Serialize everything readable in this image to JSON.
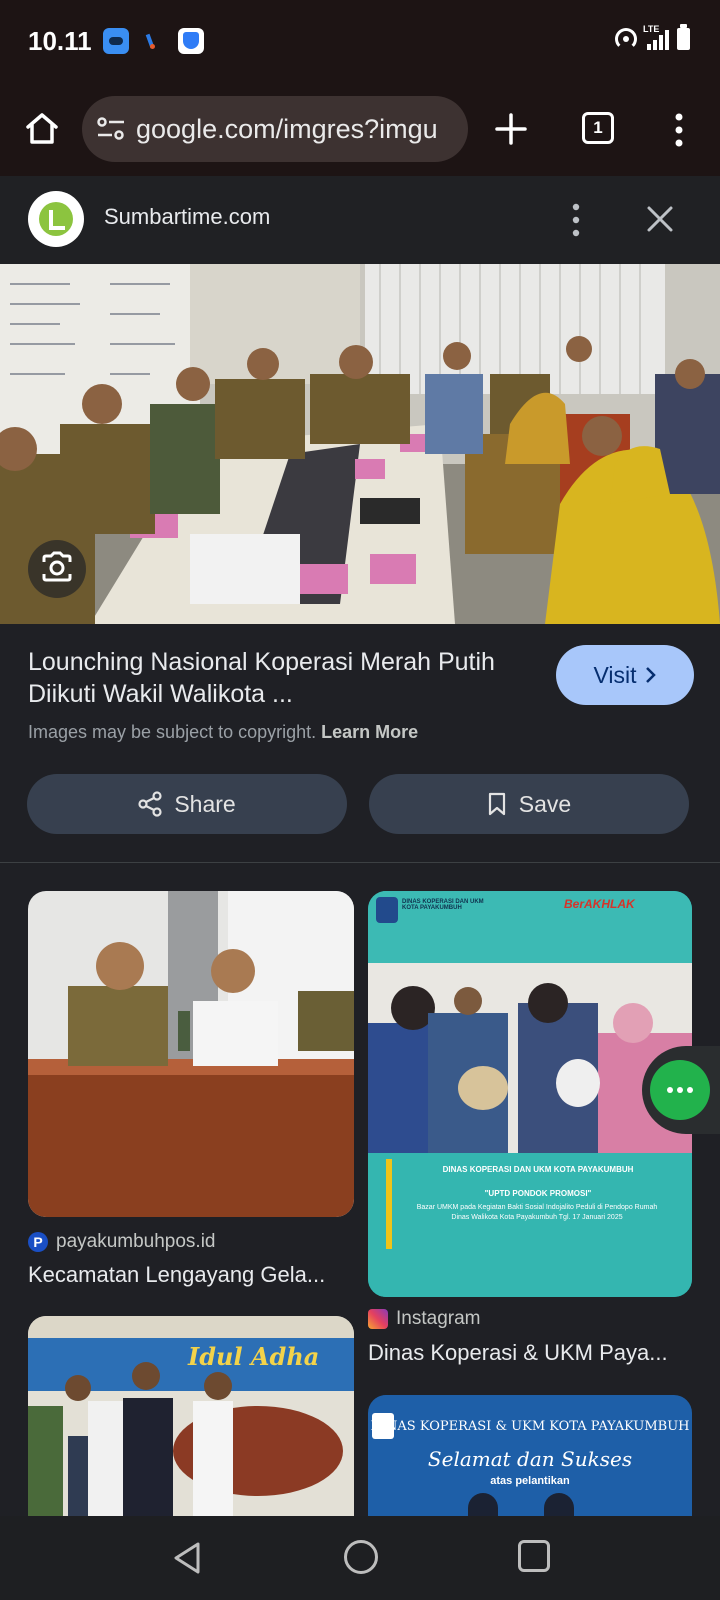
{
  "status_bar": {
    "time": "10.11",
    "network": "LTE"
  },
  "browser": {
    "url": "google.com/imgres?imgu",
    "tab_count": "1"
  },
  "card": {
    "site_name": "Sumbartime.com"
  },
  "details": {
    "title": "Lounching Nasional Koperasi Merah Putih Diikuti Wakil Walikota ...",
    "visit_label": "Visit",
    "copyright_text": "Images may be subject to copyright.",
    "learn_more": "Learn More",
    "share_label": "Share",
    "save_label": "Save"
  },
  "results": [
    {
      "source": "payakumbuhpos.id",
      "title": "Kecamatan Lengayang Gela..."
    },
    {
      "source": "Instagram",
      "title": "Dinas Koperasi & UKM Paya...",
      "banner_top": "DINAS KOPERASI DAN UKM KOTA PAYAKUMBUH",
      "banner_badge": "BerAKHLAK",
      "banner_heading": "DINAS KOPERASI DAN UKM KOTA PAYAKUMBUH",
      "banner_sub": "\"UPTD PONDOK PROMOSI\"",
      "banner_body": "Bazar UMKM pada Kegiatan Bakti Sosial Indojalito Peduli di Pendopo Rumah Dinas Walikota Kota Payakumbuh Tgl. 17 Januari 2025"
    },
    {
      "banner": "Idul Adha"
    },
    {
      "header": "DINAS KOPERASI & UKM KOTA PAYAKUMBUH",
      "script_line": "Selamat dan Sukses",
      "sub": "atas pelantikan"
    }
  ],
  "icons": {
    "home": "home-icon",
    "tune": "tune-icon",
    "plus": "plus-icon",
    "menu": "more-vert-icon",
    "close": "close-icon",
    "lens": "google-lens-icon",
    "share": "share-icon",
    "save": "bookmark-icon",
    "chevron": "chevron-right-icon",
    "back": "back-icon",
    "nav_home": "circle-home-icon",
    "recents": "recents-icon"
  },
  "colors": {
    "background": "#1f2025",
    "toolbar": "#1d1414",
    "visit_button": "#a8c7fa",
    "secondary_button": "#37404f",
    "fab": "#22b24c"
  }
}
